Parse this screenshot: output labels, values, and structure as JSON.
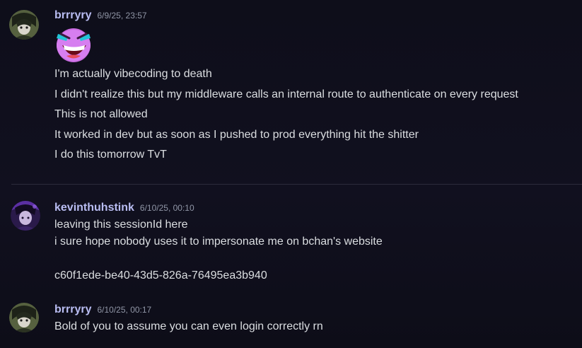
{
  "messages": [
    {
      "author": "brrryry",
      "timestamp": "6/9/25, 23:57",
      "emoji": "laughing-crying-emoji",
      "lines": [
        "I'm actually vibecoding to death",
        "I didn't realize this but my middleware calls an internal route to authenticate on every request",
        "This is not allowed",
        "It worked in dev but as soon as I pushed to prod everything hit the shitter",
        "I do this tomorrow TvT"
      ]
    },
    {
      "author": "kevinthuhstink",
      "timestamp": "6/10/25, 00:10",
      "lines": [
        "leaving this sessionId here",
        "i sure hope nobody uses it to impersonate me on bchan's website",
        "",
        "c60f1ede-be40-43d5-826a-76495ea3b940"
      ]
    },
    {
      "author": "brrryry",
      "timestamp": "6/10/25, 00:17",
      "lines": [
        "Bold of you to assume you can even login correctly rn"
      ]
    }
  ],
  "colors": {
    "background": "#0f0f1b",
    "username": "#b9bdf2",
    "timestamp": "#9096a6",
    "text": "#dbdee1",
    "divider": "#2c2c3c"
  }
}
